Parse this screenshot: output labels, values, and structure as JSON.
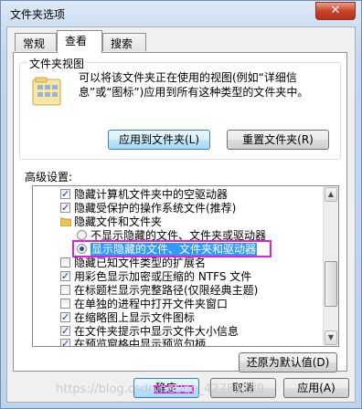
{
  "window": {
    "title": "文件夹选项",
    "close_glyph": "✕"
  },
  "tabs": [
    {
      "label": "常规",
      "active": false
    },
    {
      "label": "查看",
      "active": true
    },
    {
      "label": "搜索",
      "active": false
    }
  ],
  "folder_views": {
    "title": "文件夹视图",
    "description": "可以将该文件夹正在使用的视图(例如“详细信息”或“图标”)应用到所有这种类型的文件夹中。",
    "apply_button": "应用到文件夹(L)",
    "reset_button": "重置文件夹(R)"
  },
  "advanced": {
    "label": "高级设置:",
    "items": [
      {
        "type": "checkbox",
        "checked": true,
        "indent": 0,
        "label": "隐藏计算机文件夹中的空驱动器"
      },
      {
        "type": "checkbox",
        "checked": true,
        "indent": 0,
        "label": "隐藏受保护的操作系统文件(推荐)"
      },
      {
        "type": "folder",
        "indent": 0,
        "label": "隐藏文件和文件夹"
      },
      {
        "type": "radio",
        "checked": false,
        "indent": 1,
        "label": "不显示隐藏的文件、文件夹或驱动器"
      },
      {
        "type": "radio",
        "checked": true,
        "indent": 1,
        "label": "显示隐藏的文件、文件夹和驱动器",
        "selected": true
      },
      {
        "type": "checkbox",
        "checked": false,
        "indent": 0,
        "label": "隐藏已知文件类型的扩展名"
      },
      {
        "type": "checkbox",
        "checked": true,
        "indent": 0,
        "label": "用彩色显示加密或压缩的 NTFS 文件"
      },
      {
        "type": "checkbox",
        "checked": false,
        "indent": 0,
        "label": "在标题栏显示完整路径(仅限经典主题)"
      },
      {
        "type": "checkbox",
        "checked": false,
        "indent": 0,
        "label": "在单独的进程中打开文件夹窗口"
      },
      {
        "type": "checkbox",
        "checked": true,
        "indent": 0,
        "label": "在缩略图上显示文件图标"
      },
      {
        "type": "checkbox",
        "checked": true,
        "indent": 0,
        "label": "在文件夹提示中显示文件大小信息"
      },
      {
        "type": "checkbox",
        "checked": true,
        "indent": 0,
        "label": "在预览窗格中显示预览句柄"
      }
    ]
  },
  "restore_button": "还原为默认值(D)",
  "footer": {
    "ok": "确定",
    "cancel": "取消",
    "apply": "应用(A)"
  },
  "watermark": "https://blog.csdn.net/qq_42780289",
  "colors": {
    "highlight_box": "#e020e0",
    "selection": "#3399ff"
  }
}
